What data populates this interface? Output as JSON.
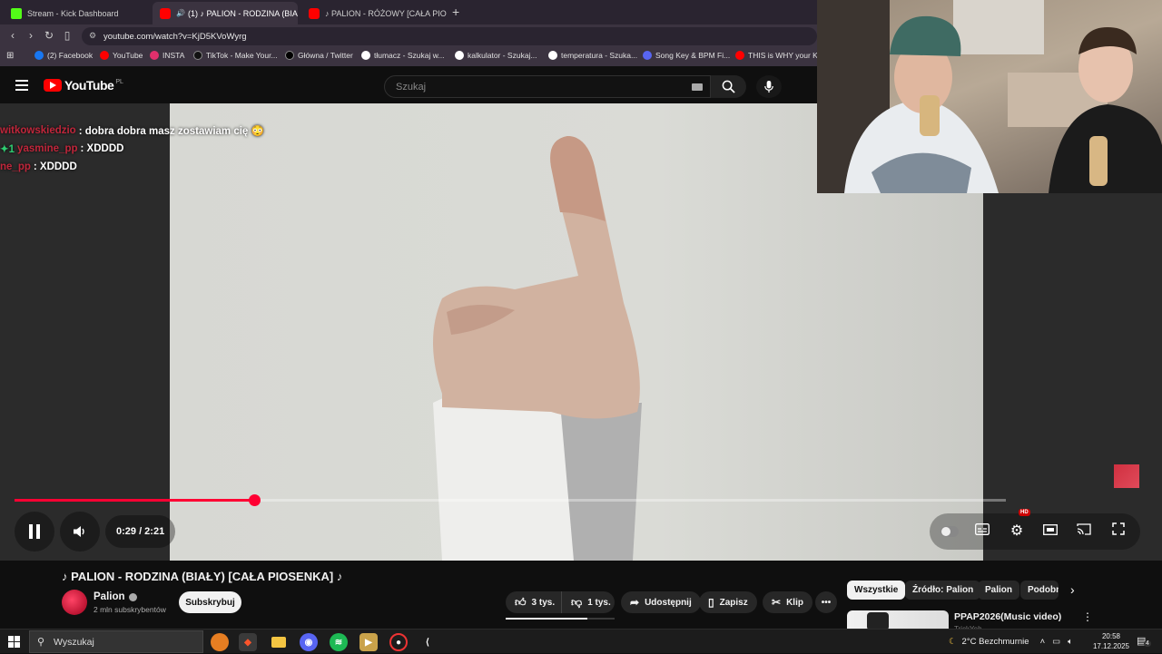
{
  "browser": {
    "tabs": [
      {
        "label": "Stream - Kick Dashboard",
        "color": "#53fc18"
      },
      {
        "label": "(1) ♪ PALION - RODZINA (BIAŁ",
        "color": "#ff0000"
      },
      {
        "label": "♪ PALION - RÓŻOWY [CAŁA PIOSENK",
        "color": "#ff0000"
      }
    ],
    "tab_close": "×",
    "new_tab": "+",
    "url": "youtube.com/watch?v=KjD5KVoWyrg",
    "bookmarks": [
      {
        "label": "(2) Facebook",
        "color": "#1877f2"
      },
      {
        "label": "YouTube",
        "color": "#ff0000"
      },
      {
        "label": "INSTA",
        "color": "#e1306c"
      },
      {
        "label": "TikTok - Make Your...",
        "color": "#111111"
      },
      {
        "label": "Główna / Twitter",
        "color": "#000000"
      },
      {
        "label": "tłumacz - Szukaj w...",
        "color": "#ffffff"
      },
      {
        "label": "kalkulator - Szukaj...",
        "color": "#ffffff"
      },
      {
        "label": "temperatura - Szuka...",
        "color": "#ffffff"
      },
      {
        "label": "Song Key & BPM Fi...",
        "color": "#5865f2"
      },
      {
        "label": "THIS is WHY your Kl...",
        "color": "#ff0000"
      }
    ]
  },
  "youtube": {
    "logo_text": "YouTube",
    "logo_country": "PL",
    "search_placeholder": "Szukaj"
  },
  "chat": [
    {
      "user": "witkowskiedzio",
      "message": ": dobra dobra masz zostawiam cię 😳"
    },
    {
      "user": "yasmine_pp",
      "message": ": XDDDD",
      "badge": "✦1"
    },
    {
      "user": "ne_pp",
      "message": ": XDDDD"
    }
  ],
  "player": {
    "time": "0:29 / 2:21",
    "progress": 0.242,
    "buffered": 1.0,
    "hd_badge": "HD"
  },
  "video": {
    "title": "♪ PALION - RODZINA (BIAŁY) [CAŁA PIOSENKA] ♪",
    "channel": "Palion",
    "subscribers": "2 mln subskrybentów",
    "subscribe_label": "Subskrybuj",
    "likes": "3 tys.",
    "dislikes": "1 tys.",
    "share_label": "Udostępnij",
    "save_label": "Zapisz",
    "clip_label": "Klip",
    "like_ratio": 0.75
  },
  "sidebar": {
    "chips": [
      "Wszystkie",
      "Źródło: Palion",
      "Palion",
      "Podobne"
    ],
    "recommendation": {
      "title": "PPAP2026(Music video)",
      "channel": "TrickYeh"
    }
  },
  "taskbar": {
    "search_placeholder": "Wyszukaj",
    "weather": "2°C  Bezchmurnie",
    "time": "20:58",
    "date": "17.12.2025",
    "notifications": "4"
  }
}
